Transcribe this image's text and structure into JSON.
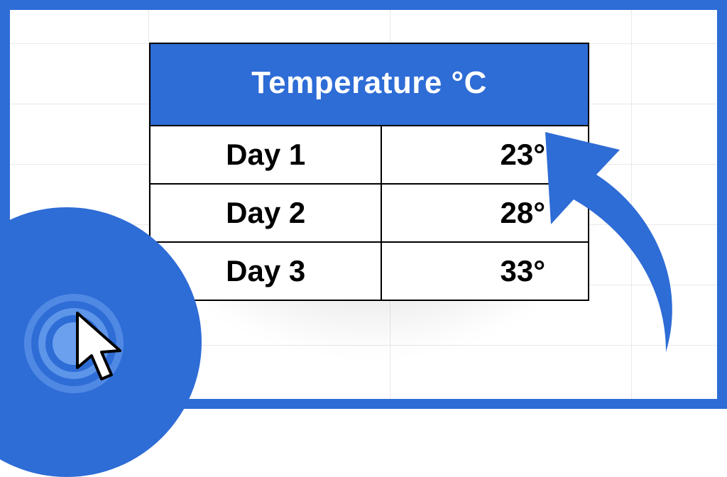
{
  "table": {
    "header": "Temperature °C",
    "rows": [
      {
        "label": "Day 1",
        "value": "23°"
      },
      {
        "label": "Day 2",
        "value": "28°"
      },
      {
        "label": "Day 3",
        "value": "33°"
      }
    ]
  },
  "colors": {
    "accent": "#2e6cd6"
  }
}
